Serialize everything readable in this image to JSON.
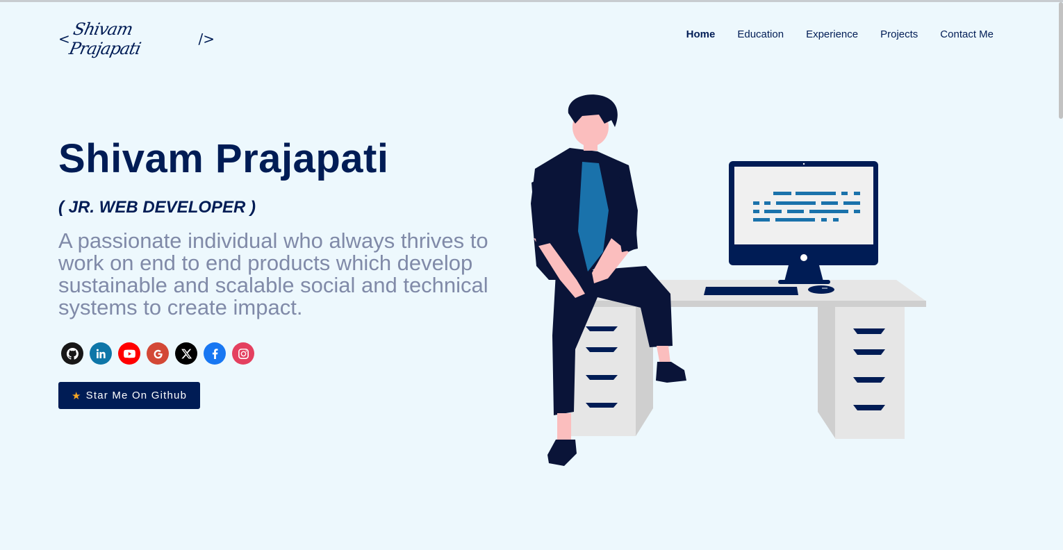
{
  "header": {
    "logo": {
      "open_bracket": "<",
      "signature": "Shivam Prajapati",
      "close_bracket": "/>"
    },
    "nav": [
      {
        "label": "Home",
        "active": true
      },
      {
        "label": "Education",
        "active": false
      },
      {
        "label": "Experience",
        "active": false
      },
      {
        "label": "Projects",
        "active": false
      },
      {
        "label": "Contact Me",
        "active": false
      }
    ]
  },
  "hero": {
    "name": "Shivam Prajapati",
    "role": "( JR. WEB DEVELOPER )",
    "intro": "A passionate individual who always thrives to work on end to end products which develop sustainable and scalable social and technical systems to create impact.",
    "socials": [
      {
        "name": "github-icon",
        "color": "#181717"
      },
      {
        "name": "linkedin-icon",
        "color": "#0e76a8"
      },
      {
        "name": "youtube-icon",
        "color": "#ff0000"
      },
      {
        "name": "google-icon",
        "color": "#d34836"
      },
      {
        "name": "x-icon",
        "color": "#000000"
      },
      {
        "name": "facebook-icon",
        "color": "#1877f2"
      },
      {
        "name": "instagram-icon",
        "color": "#e4405f"
      }
    ],
    "star_button": "Star Me On Github",
    "star_icon": "star-icon"
  },
  "colors": {
    "background": "#edf8fd",
    "primary": "#001c55",
    "muted_text": "#808aa8",
    "accent_blue": "#1a72ab"
  }
}
